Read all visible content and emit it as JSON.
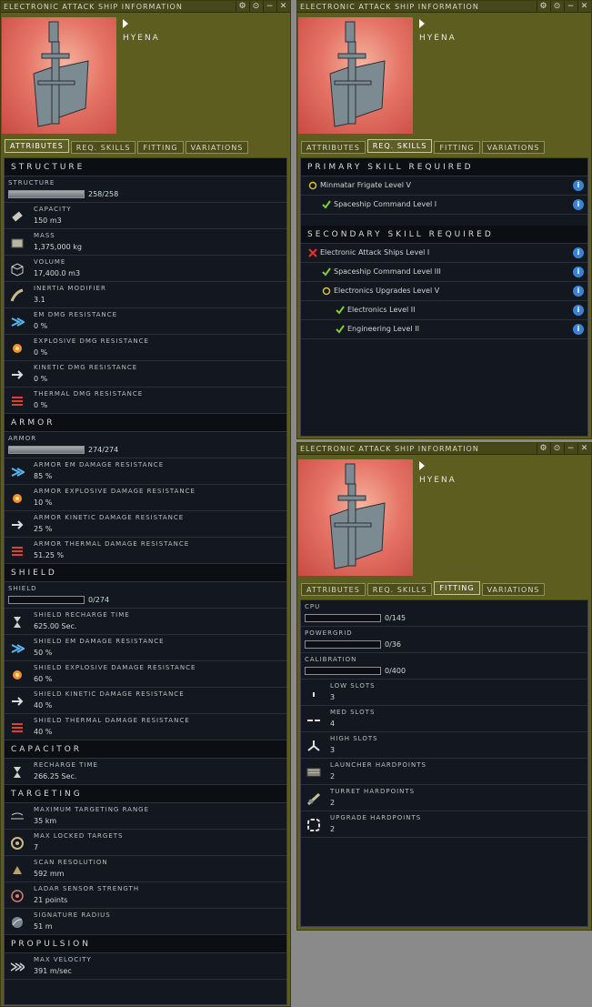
{
  "window_title": "ELECTRONIC ATTACK SHIP INFORMATION",
  "ship_name": "HYENA",
  "title_buttons": {
    "settings": "⚙",
    "pin": "⊙",
    "minimize": "−",
    "close": "✕"
  },
  "tabs": [
    "ATTRIBUTES",
    "REQ. SKILLS",
    "FITTING",
    "VARIATIONS"
  ],
  "attributes": {
    "structure_header": "STRUCTURE",
    "structure": {
      "label": "STRUCTURE",
      "value": "258/258",
      "fill": 1.0
    },
    "capacity": {
      "label": "CAPACITY",
      "value": "150 m3"
    },
    "mass": {
      "label": "MASS",
      "value": "1,375,000 kg"
    },
    "volume": {
      "label": "VOLUME",
      "value": "17,400.0 m3"
    },
    "inertia": {
      "label": "INERTIA MODIFIER",
      "value": "3.1"
    },
    "em": {
      "label": "EM DMG RESISTANCE",
      "value": "0 %"
    },
    "explosive": {
      "label": "EXPLOSIVE DMG RESISTANCE",
      "value": "0 %"
    },
    "kinetic": {
      "label": "KINETIC DMG RESISTANCE",
      "value": "0 %"
    },
    "thermal": {
      "label": "THERMAL DMG RESISTANCE",
      "value": "0 %"
    },
    "armor_header": "ARMOR",
    "armor": {
      "label": "ARMOR",
      "value": "274/274",
      "fill": 1.0
    },
    "armor_em": {
      "label": "ARMOR EM DAMAGE RESISTANCE",
      "value": "85 %"
    },
    "armor_explosive": {
      "label": "ARMOR EXPLOSIVE DAMAGE RESISTANCE",
      "value": "10 %"
    },
    "armor_kinetic": {
      "label": "ARMOR KINETIC DAMAGE RESISTANCE",
      "value": "25 %"
    },
    "armor_thermal": {
      "label": "ARMOR THERMAL DAMAGE RESISTANCE",
      "value": "51.25 %"
    },
    "shield_header": "SHIELD",
    "shield": {
      "label": "SHIELD",
      "value": "0/274",
      "fill": 0
    },
    "shield_recharge": {
      "label": "SHIELD RECHARGE TIME",
      "value": "625.00 Sec."
    },
    "shield_em": {
      "label": "SHIELD EM DAMAGE RESISTANCE",
      "value": "50 %"
    },
    "shield_explosive": {
      "label": "SHIELD EXPLOSIVE DAMAGE RESISTANCE",
      "value": "60 %"
    },
    "shield_kinetic": {
      "label": "SHIELD KINETIC DAMAGE RESISTANCE",
      "value": "40 %"
    },
    "shield_thermal": {
      "label": "SHIELD THERMAL DAMAGE RESISTANCE",
      "value": "40 %"
    },
    "capacitor_header": "CAPACITOR",
    "recharge": {
      "label": "RECHARGE TIME",
      "value": "266.25 Sec."
    },
    "targeting_header": "TARGETING",
    "max_range": {
      "label": "MAXIMUM TARGETING RANGE",
      "value": "35 km"
    },
    "max_targets": {
      "label": "MAX LOCKED TARGETS",
      "value": "7"
    },
    "scan_res": {
      "label": "SCAN RESOLUTION",
      "value": "592 mm"
    },
    "ladar": {
      "label": "LADAR SENSOR STRENGTH",
      "value": "21 points"
    },
    "sig_radius": {
      "label": "SIGNATURE RADIUS",
      "value": "51 m"
    },
    "propulsion_header": "PROPULSION",
    "velocity": {
      "label": "MAX VELOCITY",
      "value": "391 m/sec"
    }
  },
  "skills": {
    "primary_header": "PRIMARY SKILL REQUIRED",
    "secondary_header": "SECONDARY SKILL REQUIRED",
    "primary": [
      {
        "name": "Minmatar Frigate Level V",
        "status": "circle"
      },
      {
        "name": "Spaceship Command Level I",
        "status": "check"
      }
    ],
    "secondary": [
      {
        "name": "Electronic Attack Ships Level I",
        "status": "cross"
      },
      {
        "name": "Spaceship Command Level III",
        "status": "check"
      },
      {
        "name": "Electronics Upgrades Level V",
        "status": "circle"
      },
      {
        "name": "Electronics Level II",
        "status": "check"
      },
      {
        "name": "Engineering Level II",
        "status": "check"
      }
    ],
    "info_glyph": "i"
  },
  "fitting": {
    "cpu": {
      "label": "CPU",
      "value": "0/145",
      "fill": 0
    },
    "powergrid": {
      "label": "POWERGRID",
      "value": "0/36",
      "fill": 0
    },
    "calibration": {
      "label": "CALIBRATION",
      "value": "0/400",
      "fill": 0
    },
    "low": {
      "label": "LOW SLOTS",
      "value": "3"
    },
    "med": {
      "label": "MED SLOTS",
      "value": "4"
    },
    "high": {
      "label": "HIGH SLOTS",
      "value": "3"
    },
    "launcher": {
      "label": "LAUNCHER HARDPOINTS",
      "value": "2"
    },
    "turret": {
      "label": "TURRET HARDPOINTS",
      "value": "2"
    },
    "upgrade": {
      "label": "UPGRADE HARDPOINTS",
      "value": "2"
    }
  },
  "colors": {
    "window": "#5c5d1e",
    "panel": "#131820",
    "info": "#3b82d6",
    "check": "#7fd02a",
    "cross": "#e83030",
    "circle": "#d8c030"
  }
}
